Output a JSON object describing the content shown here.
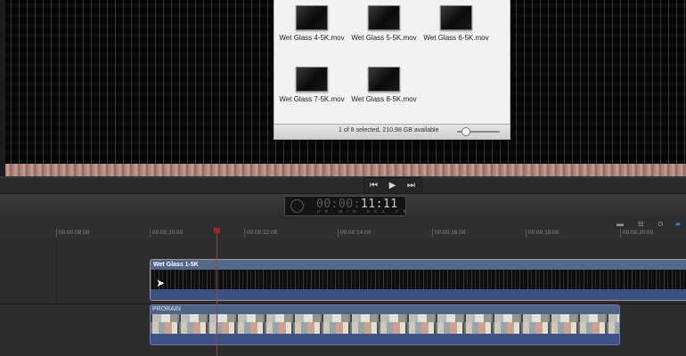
{
  "finder": {
    "files": [
      {
        "name": "Wet Glass 4-5K.mov"
      },
      {
        "name": "Wet Glass 5-5K.mov"
      },
      {
        "name": "Wet Glass 6-5K.mov"
      },
      {
        "name": "Wet Glass 7-5K.mov"
      },
      {
        "name": "Wet Glass 8-5K.mov"
      }
    ],
    "status": "1 of 8 selected, 210.98 GB available"
  },
  "transport": {
    "prev_icon": "skip-back-icon",
    "play_icon": "play-icon",
    "next_icon": "skip-forward-icon"
  },
  "dashboard": {
    "timecode_dim": "00:00:",
    "timecode_bright": "11:11",
    "labels": "HR MIN SEC FR"
  },
  "ruler": {
    "labels": [
      "00:00:08:00",
      "00:00:10:00",
      "00:00:12:00",
      "00:00:14:00",
      "00:00:16:00",
      "00:00:18:00",
      "00:00:20:00"
    ]
  },
  "clips": {
    "primary": {
      "title": "Wet Glass 1-5K"
    },
    "secondary": {
      "title": "PRORAIN"
    }
  },
  "colors": {
    "clip_blue": "#3d4a63",
    "playhead": "#a12323",
    "accent_blue": "#2f7fe0"
  }
}
